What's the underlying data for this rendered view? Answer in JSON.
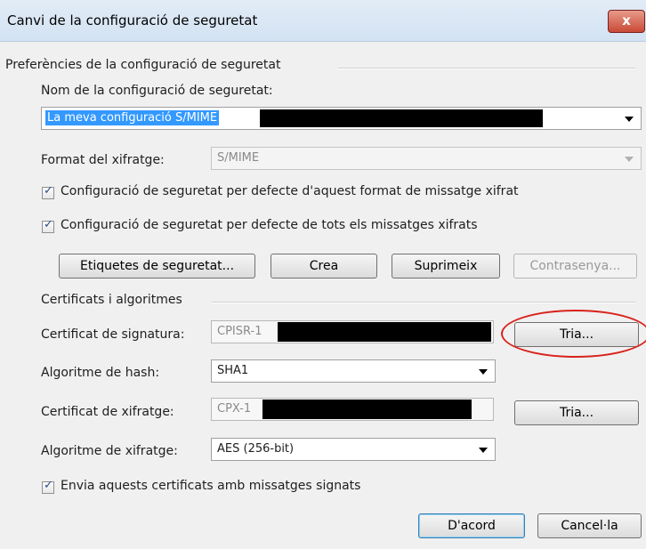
{
  "window": {
    "title": "Canvi de la configuració de seguretat",
    "close_label": "x"
  },
  "prefs": {
    "group_label": "Preferències de la configuració de seguretat",
    "name_label": "Nom de la configuració de seguretat:",
    "name_value": "La meva configuració S/MIME",
    "format_label": "Format del xifratge:",
    "format_value": "S/MIME",
    "checkbox1": {
      "label": "Configuració de seguretat per defecte d'aquest format de missatge xifrat",
      "checked": true
    },
    "checkbox2": {
      "label": "Configuració de seguretat per defecte de tots els missatges xifrats",
      "checked": true
    },
    "buttons": {
      "labels": "Etiquetes de seguretat...",
      "create": "Crea",
      "delete": "Suprimeix",
      "password": "Contrasenya..."
    }
  },
  "certs": {
    "group_label": "Certificats i algoritmes",
    "signing_label": "Certificat de signatura:",
    "signing_value": "CPISR-1",
    "choose1": "Tria...",
    "hash_label": "Algoritme de hash:",
    "hash_value": "SHA1",
    "encryption_label": "Certificat de xifratge:",
    "encryption_value": "CPX-1",
    "choose2": "Tria...",
    "enc_algo_label": "Algoritme de xifratge:",
    "enc_algo_value": "AES (256-bit)",
    "send_certs": {
      "label": "Envia aquests certificats amb missatges signats",
      "checked": true
    }
  },
  "footer": {
    "ok": "D'acord",
    "cancel": "Cancel·la"
  },
  "colors": {
    "highlight": "#3399ff",
    "annotation": "#d9231d"
  }
}
